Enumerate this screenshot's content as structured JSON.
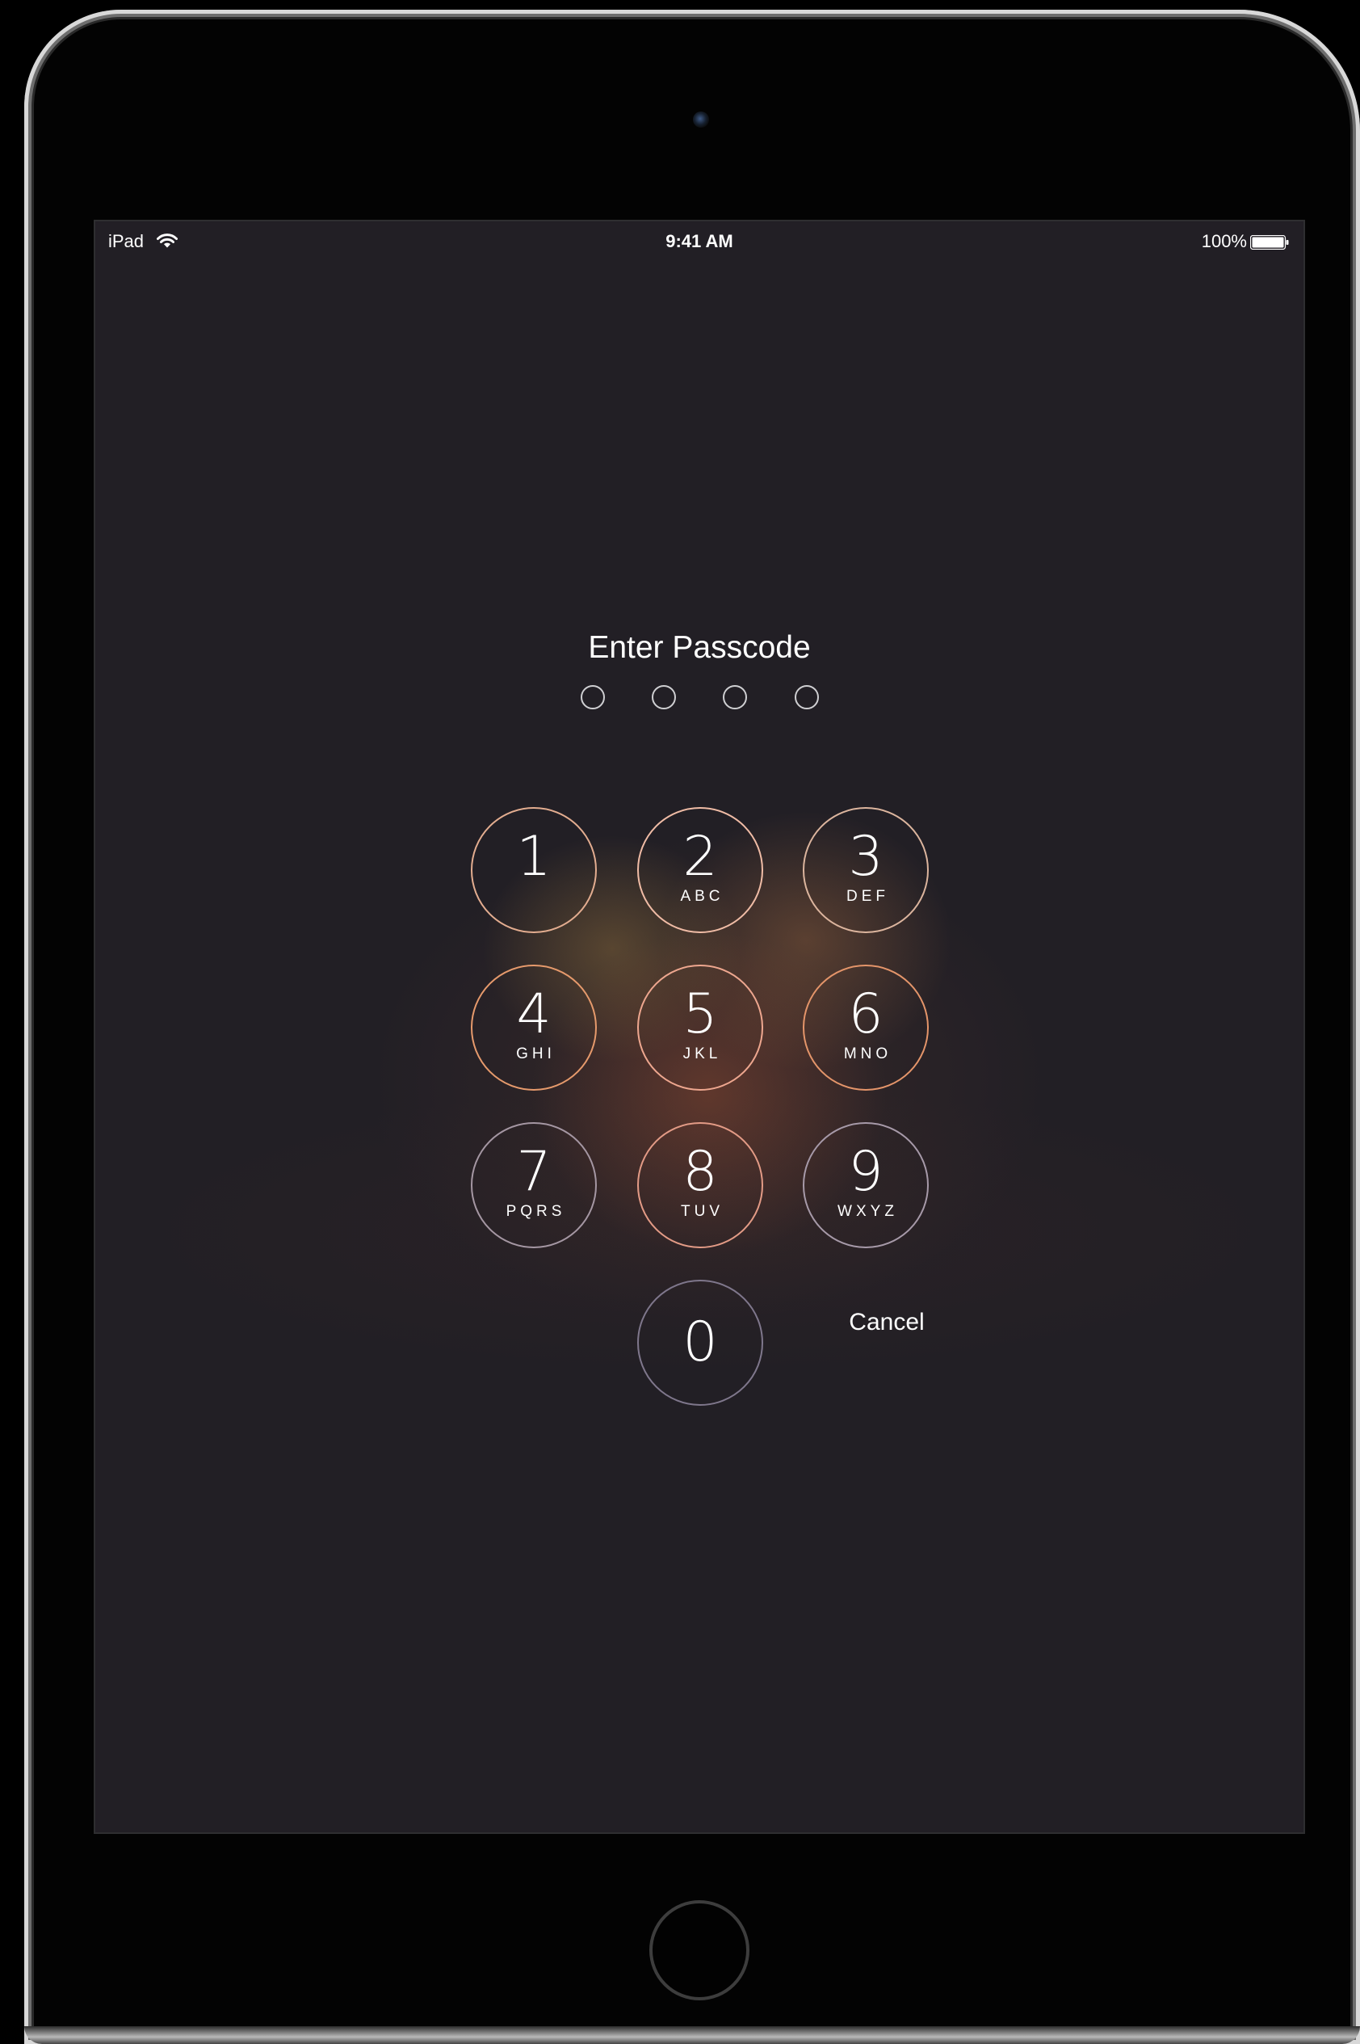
{
  "status_bar": {
    "carrier": "iPad",
    "time": "9:41 AM",
    "battery_percent": "100%",
    "wifi_icon": "wifi-icon",
    "battery_icon": "battery-full-icon"
  },
  "passcode": {
    "title": "Enter Passcode",
    "digits_entered": 0,
    "digits_total": 4
  },
  "keypad": {
    "keys": [
      {
        "digit": "1",
        "letters": ""
      },
      {
        "digit": "2",
        "letters": "ABC"
      },
      {
        "digit": "3",
        "letters": "DEF"
      },
      {
        "digit": "4",
        "letters": "GHI"
      },
      {
        "digit": "5",
        "letters": "JKL"
      },
      {
        "digit": "6",
        "letters": "MNO"
      },
      {
        "digit": "7",
        "letters": "PQRS"
      },
      {
        "digit": "8",
        "letters": "TUV"
      },
      {
        "digit": "9",
        "letters": "WXYZ"
      },
      {
        "digit": "0",
        "letters": ""
      }
    ],
    "cancel_label": "Cancel"
  },
  "device": {
    "model": "iPad",
    "home_button_icon": "home-button",
    "camera_icon": "camera-icon"
  },
  "colors": {
    "screen_background": "#221f25",
    "key_ring_glow": "#e8b08c",
    "text": "#ffffff"
  }
}
